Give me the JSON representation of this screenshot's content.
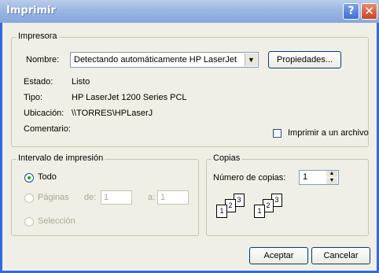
{
  "window": {
    "title": "Imprimir",
    "help_label": "?",
    "close_label": "✕"
  },
  "printer": {
    "group_label": "Impresora",
    "name_label": "Nombre:",
    "name_value": "Detectando automáticamente HP LaserJet",
    "properties_button": "Propiedades...",
    "status_label": "Estado:",
    "status_value": "Listo",
    "type_label": "Tipo:",
    "type_value": "HP LaserJet 1200 Series PCL",
    "location_label": "Ubicación:",
    "location_value": "\\\\TORRES\\HPLaserJ",
    "comment_label": "Comentario:",
    "print_to_file_label": "Imprimir a un archivo"
  },
  "range": {
    "group_label": "Intervalo de impresión",
    "all_label": "Todo",
    "pages_label": "Páginas",
    "from_label": "de:",
    "from_value": "1",
    "to_label": "a:",
    "to_value": "1",
    "selection_label": "Selección"
  },
  "copies": {
    "group_label": "Copias",
    "count_label": "Número de copias:",
    "count_value": "1",
    "pages_1": "1",
    "pages_2": "2",
    "pages_3": "3"
  },
  "actions": {
    "accept": "Aceptar",
    "cancel": "Cancelar"
  },
  "colors": {
    "title_gradient_top": "#b9cde9",
    "frame": "#2f6ae0",
    "dialog_bg": "#f0efe6"
  }
}
